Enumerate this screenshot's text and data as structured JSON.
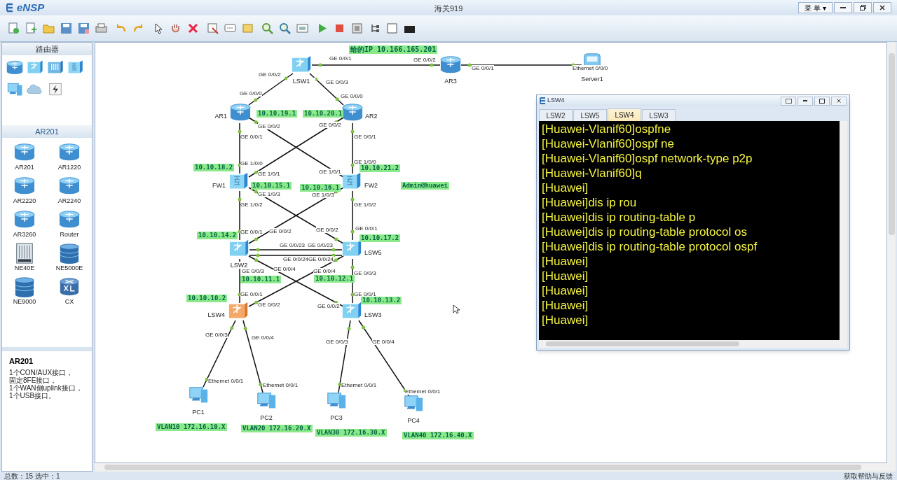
{
  "window": {
    "logo": "eNSP",
    "title": "海关919",
    "menu": "菜 单",
    "menu_caret": "▾"
  },
  "palette": {
    "category_title": "路由器",
    "model_title": "AR201",
    "models": [
      {
        "label": "AR201",
        "kind": "router"
      },
      {
        "label": "AR1220",
        "kind": "router"
      },
      {
        "label": "AR2220",
        "kind": "router"
      },
      {
        "label": "AR2240",
        "kind": "router"
      },
      {
        "label": "AR3260",
        "kind": "router"
      },
      {
        "label": "Router",
        "kind": "router"
      },
      {
        "label": "NE40E",
        "kind": "chassis"
      },
      {
        "label": "NE5000E",
        "kind": "stack"
      },
      {
        "label": "NE9000",
        "kind": "stack"
      },
      {
        "label": "CX",
        "kind": "cx"
      }
    ],
    "info_title": "AR201",
    "info_lines": [
      "1个CON/AUX接口，",
      "固定8FE接口，",
      "1个WAN侧uplink接口，",
      "1个USB接口。"
    ]
  },
  "canvas": {
    "devices": [
      {
        "label": "LSW1",
        "kind": "switch"
      },
      {
        "label": "AR3",
        "kind": "router"
      },
      {
        "label": "Server1",
        "kind": "server"
      },
      {
        "label": "AR1",
        "kind": "router"
      },
      {
        "label": "AR2",
        "kind": "router"
      },
      {
        "label": "FW1",
        "kind": "firewall"
      },
      {
        "label": "FW2",
        "kind": "firewall"
      },
      {
        "label": "LSW2",
        "kind": "switch"
      },
      {
        "label": "LSW5",
        "kind": "switch"
      },
      {
        "label": "LSW4",
        "kind": "core-switch"
      },
      {
        "label": "LSW3",
        "kind": "switch"
      },
      {
        "label": "PC1",
        "kind": "pc"
      },
      {
        "label": "PC2",
        "kind": "pc"
      },
      {
        "label": "PC3",
        "kind": "pc"
      },
      {
        "label": "PC4",
        "kind": "pc"
      }
    ],
    "port_labels": [
      "GE 0/0/1",
      "GE 0/0/2",
      "GE 0/0/1",
      "Ethernet 0/0/0",
      "GE 0/0/2",
      "GE 0/0/3",
      "GE 0/0/0",
      "GE 0/0/0",
      "GE 0/0/2",
      "GE 0/0/2",
      "GE 0/0/1",
      "GE 0/0/1",
      "GE 1/0/0",
      "GE 1/0/0",
      "GE 1/0/1",
      "GE 1/0/1",
      "GE 1/0/3",
      "GE 1/0/3",
      "GE 1/0/2",
      "GE 1/0/2",
      "GE 0/0/1",
      "GE 0/0/2",
      "GE 0/0/2",
      "GE 0/0/1",
      "GE 0/0/23",
      "GE 0/0/23",
      "GE 0/0/24",
      "GE 0/0/24",
      "GE 0/0/4",
      "GE 0/0/3",
      "GE 0/0/4",
      "GE 0/0/3",
      "GE 0/0/1",
      "GE 0/0/1",
      "GE 0/0/2",
      "GE 0/0/2",
      "GE 0/0/3",
      "GE 0/0/4",
      "GE 0/0/3",
      "GE 0/0/4",
      "Ethernet 0/0/1",
      "Ethernet 0/0/1",
      "Ethernet 0/0/1",
      "Ethernet 0/0/1"
    ],
    "notes": [
      "给的IP 10.166.165.201",
      "10.10.19.1",
      "10.10.20.1",
      "10.10.18.2",
      "10.10.21.2",
      "10.10.15.1",
      "10.10.16.1",
      "Admin@huawei",
      "10.10.14.2",
      "10.10.17.2",
      "10.10.11.1",
      "10.10.12.1",
      "10.10.10.2",
      "10.10.13.2",
      "VLAN10 172.16.10.X",
      "VLAN20 172.16.20.X",
      "VLAN30 172.16.30.X",
      "VLAN40 172.16.40.X"
    ]
  },
  "terminal": {
    "title": "LSW4",
    "tabs": [
      {
        "label": "LSW2",
        "selected": false
      },
      {
        "label": "LSW5",
        "selected": false
      },
      {
        "label": "LSW4",
        "selected": true
      },
      {
        "label": "LSW3",
        "selected": false
      }
    ],
    "lines": [
      "[Huawei-Vlanif60]ospfne",
      "[Huawei-Vlanif60]ospf ne",
      "[Huawei-Vlanif60]ospf network-type p2p",
      "[Huawei-Vlanif60]q",
      "[Huawei]",
      "[Huawei]dis ip rou",
      "[Huawei]dis ip routing-table p",
      "[Huawei]dis ip routing-table protocol os",
      "[Huawei]dis ip routing-table protocol ospf",
      "[Huawei]",
      "[Huawei]",
      "[Huawei]",
      "[Huawei]",
      "[Huawei]"
    ]
  },
  "status_bar": {
    "left": "总数：15 选中：1",
    "right": "获取帮助与反馈"
  }
}
